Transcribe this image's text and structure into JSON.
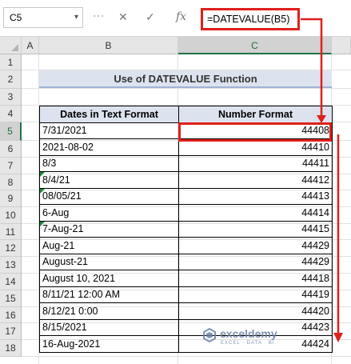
{
  "formula_bar": {
    "name_box": "C5",
    "name_box_dropdown_icon": "chevron-down-icon",
    "cancel_icon": "close-icon",
    "enter_icon": "check-icon",
    "fx_label": "fx",
    "formula": "=DATEVALUE(B5)"
  },
  "columns": [
    "A",
    "B",
    "C"
  ],
  "rows": [
    "1",
    "2",
    "3",
    "4",
    "5",
    "6",
    "7",
    "8",
    "9",
    "10",
    "11",
    "12",
    "13",
    "14",
    "15",
    "16",
    "17",
    "18"
  ],
  "title": "Use of DATEVALUE Function",
  "table": {
    "headers": [
      "Dates in Text Format",
      "Number Format"
    ],
    "rows": [
      {
        "text": "7/31/2021",
        "number": "44408",
        "flag": false
      },
      {
        "text": "2021-08-02",
        "number": "44410",
        "flag": false
      },
      {
        "text": "8/3",
        "number": "44411",
        "flag": false
      },
      {
        "text": "8/4/21",
        "number": "44412",
        "flag": true
      },
      {
        "text": "08/05/21",
        "number": "44413",
        "flag": true
      },
      {
        "text": "6-Aug",
        "number": "44414",
        "flag": false
      },
      {
        "text": "7-Aug-21",
        "number": "44415",
        "flag": true
      },
      {
        "text": "Aug-21",
        "number": "44429",
        "flag": false
      },
      {
        "text": "August-21",
        "number": "44429",
        "flag": false
      },
      {
        "text": "August 10, 2021",
        "number": "44418",
        "flag": false
      },
      {
        "text": "8/11/21 12:00 AM",
        "number": "44419",
        "flag": false
      },
      {
        "text": "8/12/21 0:00",
        "number": "44420",
        "flag": false
      },
      {
        "text": "8/15/2021",
        "number": "44423",
        "flag": false
      },
      {
        "text": "16-Aug-2021",
        "number": "44424",
        "flag": false
      }
    ]
  },
  "annotation_color": "#e0201b",
  "watermark": {
    "name": "exceldemy",
    "tagline": "EXCEL · DATA · BI"
  }
}
